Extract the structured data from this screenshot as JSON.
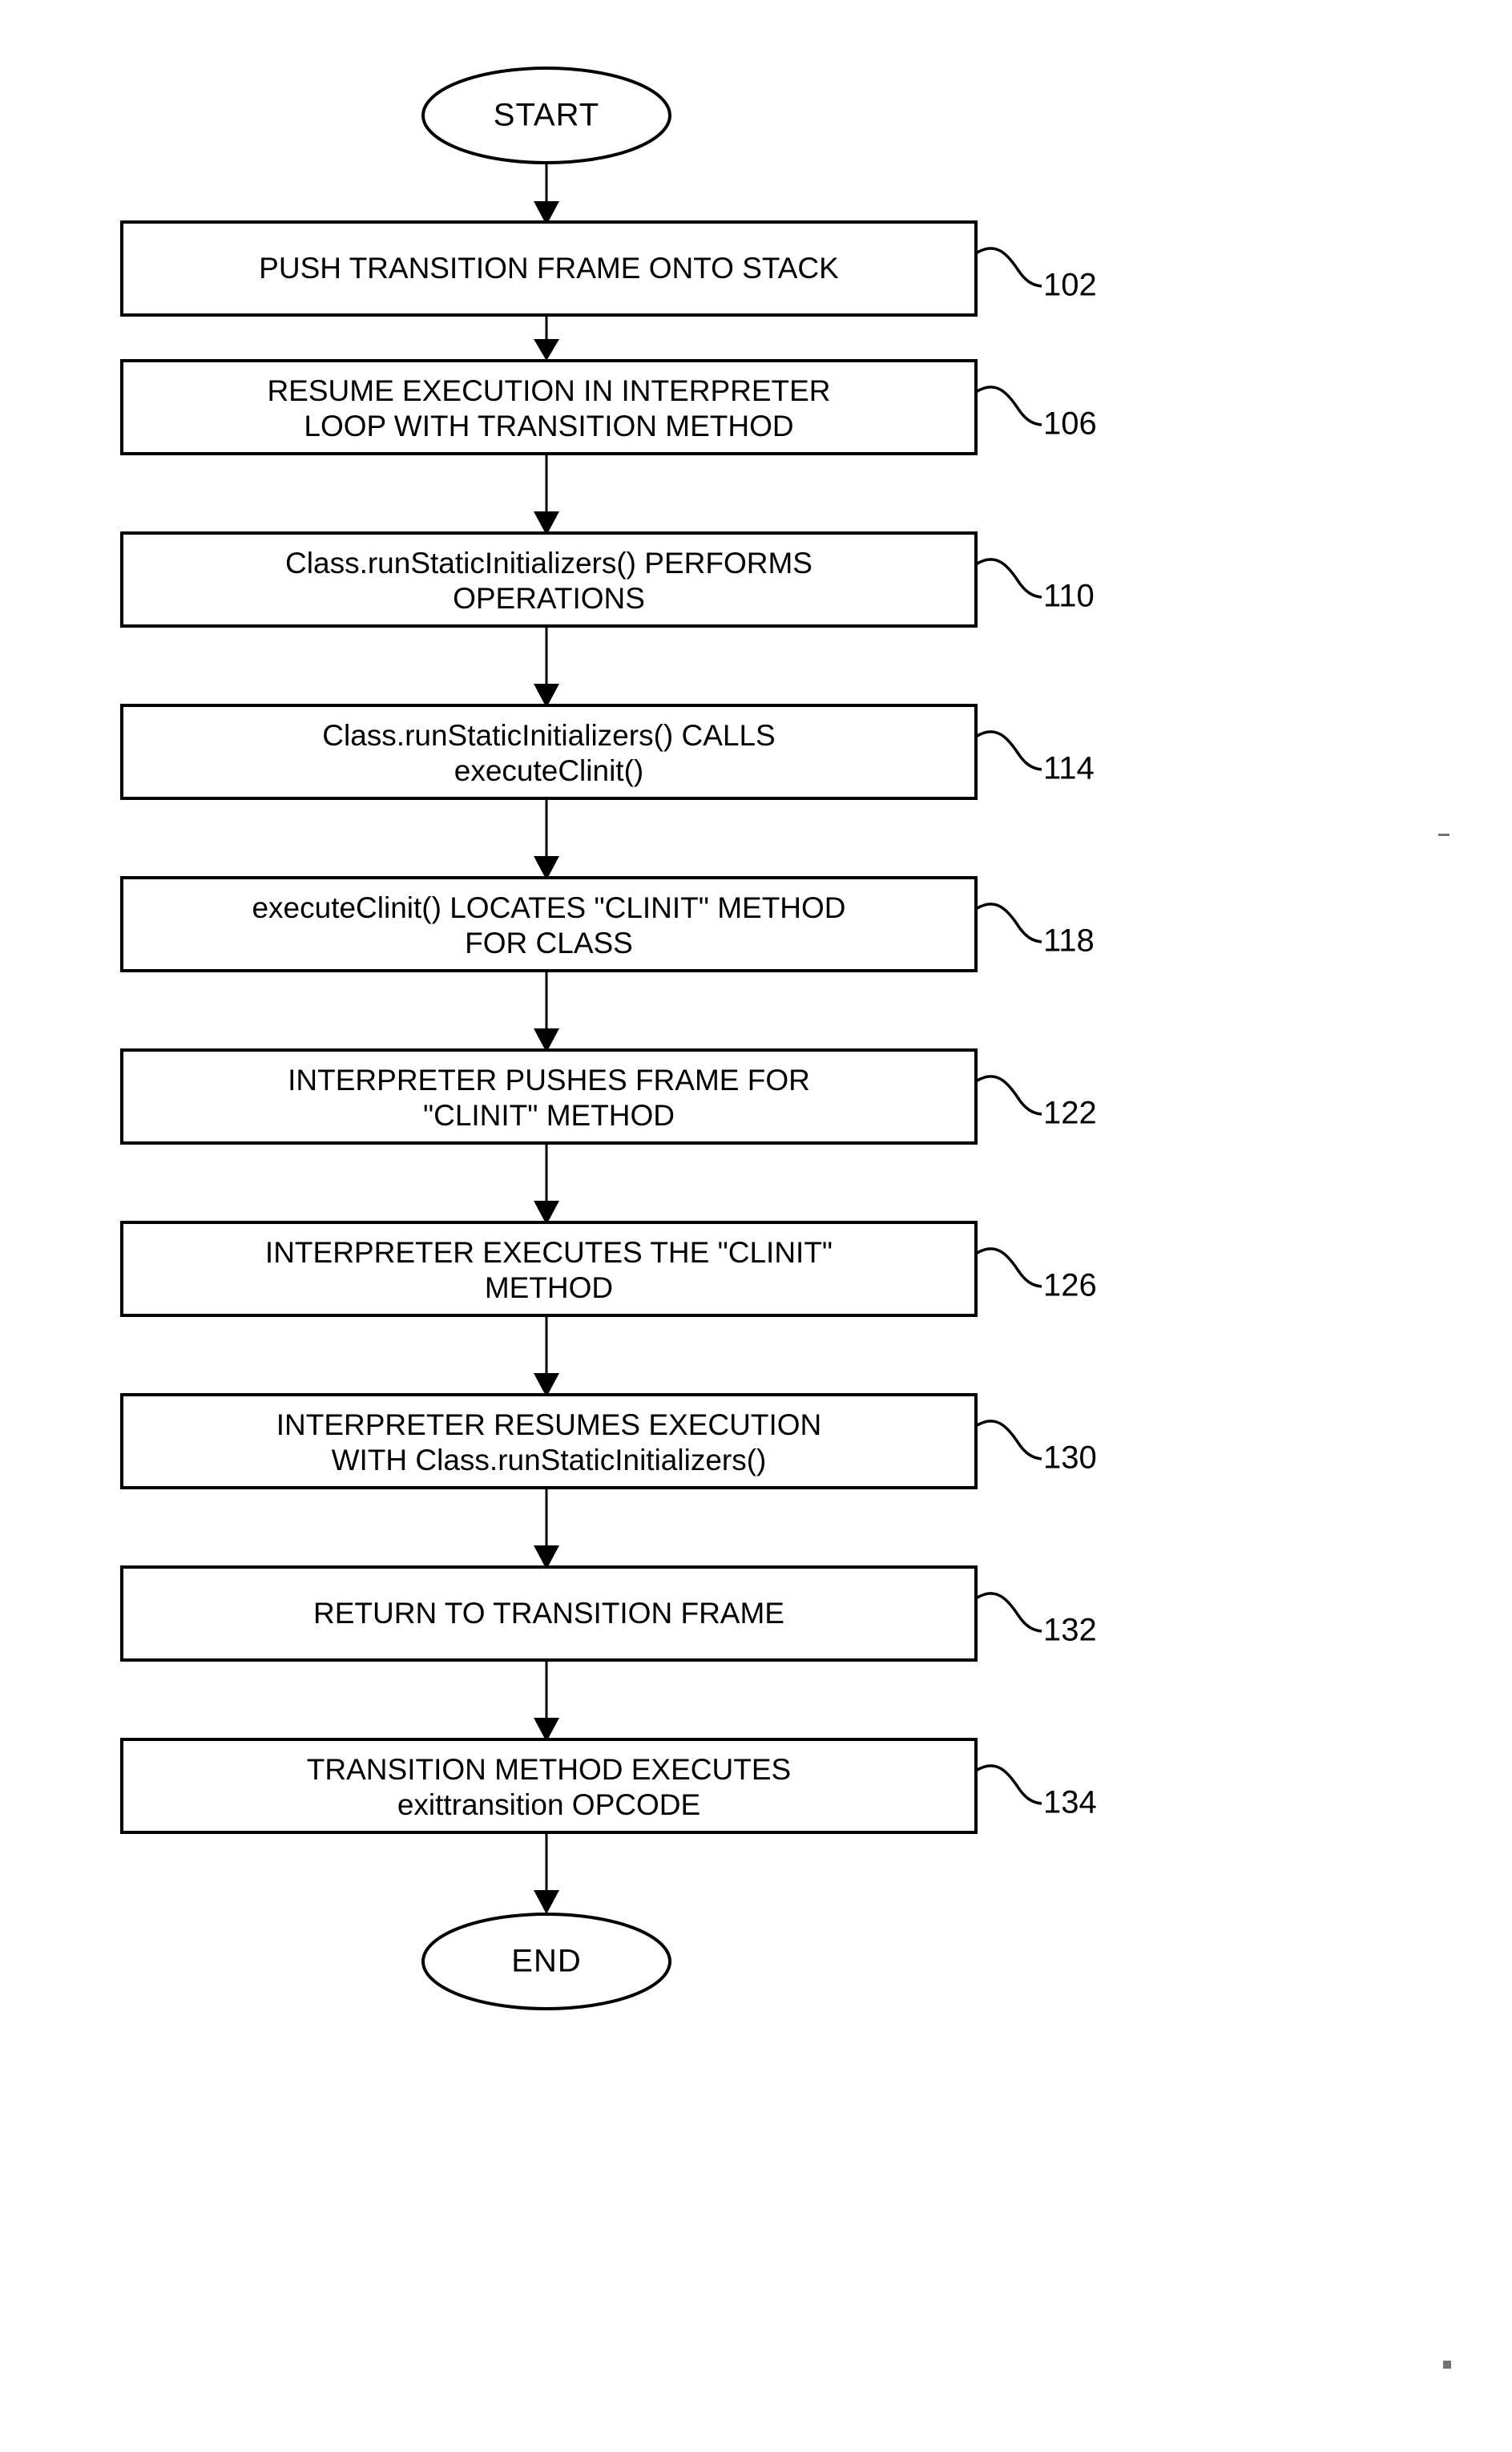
{
  "diagram": {
    "title": "Flowchart of transition frame and class static initializer execution",
    "start_label": "START",
    "end_label": "END",
    "accent_color": "#000000",
    "background_color": "#ffffff",
    "steps": [
      {
        "ref": "102",
        "lines": [
          "PUSH TRANSITION FRAME ONTO STACK"
        ],
        "case": "upper"
      },
      {
        "ref": "106",
        "lines": [
          "RESUME EXECUTION IN INTERPRETER",
          "LOOP WITH TRANSITION METHOD"
        ],
        "case": "upper"
      },
      {
        "ref": "110",
        "lines": [
          "Class.runStaticInitializers() PERFORMS",
          "OPERATIONS"
        ],
        "case": "mixed"
      },
      {
        "ref": "114",
        "lines": [
          "Class.runStaticInitializers() CALLS",
          "executeClinit()"
        ],
        "case": "mixed"
      },
      {
        "ref": "118",
        "lines": [
          "executeClinit() LOCATES \"CLINIT\" METHOD",
          "FOR CLASS"
        ],
        "case": "mixed"
      },
      {
        "ref": "122",
        "lines": [
          "INTERPRETER  PUSHES FRAME FOR",
          "\"CLINIT\" METHOD"
        ],
        "case": "upper"
      },
      {
        "ref": "126",
        "lines": [
          "INTERPRETER EXECUTES THE \"CLINIT\"",
          "METHOD"
        ],
        "case": "upper"
      },
      {
        "ref": "130",
        "lines": [
          "INTERPRETER RESUMES EXECUTION",
          "WITH Class.runStaticInitializers()"
        ],
        "case": "mixed"
      },
      {
        "ref": "132",
        "lines": [
          "RETURN TO TRANSITION FRAME"
        ],
        "case": "upper"
      },
      {
        "ref": "134",
        "lines": [
          "TRANSITION METHOD EXECUTES",
          "exittransition OPCODE"
        ],
        "case": "mixed"
      }
    ]
  }
}
